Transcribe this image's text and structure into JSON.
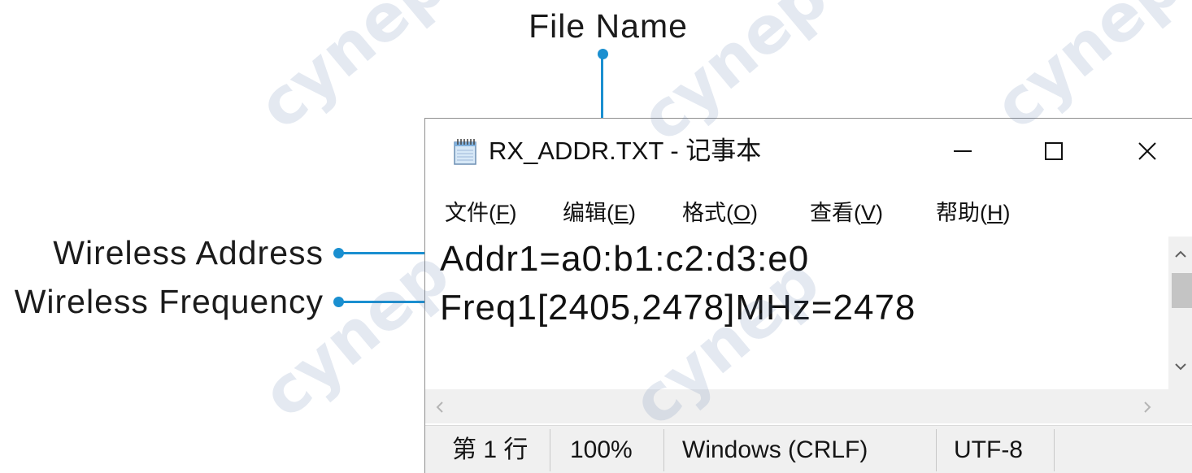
{
  "annotations": {
    "file_name": "File Name",
    "wireless_address": "Wireless Address",
    "wireless_frequency": "Wireless Frequency"
  },
  "colors": {
    "annotation": "#1a8fd0",
    "chrome": "#f0f0f0"
  },
  "window": {
    "title": "RX_ADDR.TXT - 记事本",
    "icon": "notepad-icon",
    "controls": [
      "minimize-icon",
      "maximize-icon",
      "close-icon"
    ]
  },
  "menu": [
    {
      "prefix": "文件(",
      "key": "F",
      "suffix": ")"
    },
    {
      "prefix": "编辑(",
      "key": "E",
      "suffix": ")"
    },
    {
      "prefix": "格式(",
      "key": "O",
      "suffix": ")"
    },
    {
      "prefix": "查看(",
      "key": "V",
      "suffix": ")"
    },
    {
      "prefix": "帮助(",
      "key": "H",
      "suffix": ")"
    }
  ],
  "editor": {
    "lines": [
      "Addr1=a0:b1:c2:d3:e0",
      "Freq1[2405,2478]MHz=2478"
    ]
  },
  "scrollbars": {
    "vertical": {
      "up_icon": "chevron-up-icon",
      "down_icon": "chevron-down-icon"
    },
    "horizontal": {
      "left_icon": "chevron-left-icon",
      "right_icon": "chevron-right-icon"
    }
  },
  "status_bar": {
    "position": "第 1 行",
    "zoom": "100%",
    "line_ending": "Windows (CRLF)",
    "encoding": "UTF-8"
  },
  "watermark": "cynep"
}
